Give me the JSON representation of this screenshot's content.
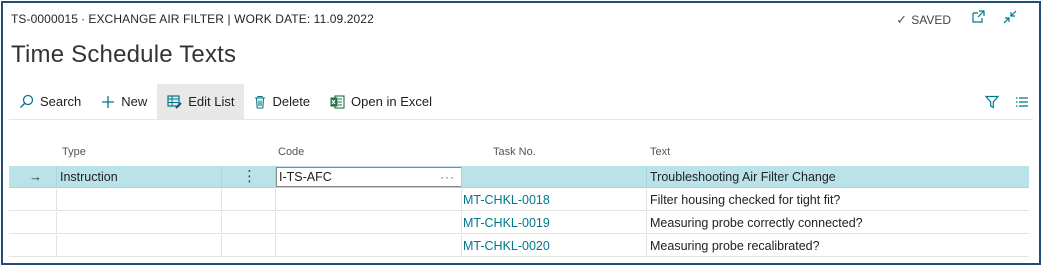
{
  "header": {
    "caption": "TS-0000015 ∙ EXCHANGE AIR FILTER | WORK DATE: 11.09.2022",
    "saved_label": "SAVED",
    "title": "Time Schedule Texts"
  },
  "actions": {
    "search": "Search",
    "new": "New",
    "edit_list": "Edit List",
    "delete": "Delete",
    "open_excel": "Open in Excel"
  },
  "columns": {
    "type": "Type",
    "code": "Code",
    "task_no": "Task No.",
    "text": "Text"
  },
  "rows": [
    {
      "type": "Instruction",
      "code": "I-TS-AFC",
      "task_no": "",
      "text": "Troubleshooting Air Filter Change"
    },
    {
      "type": "",
      "code": "",
      "task_no": "MT-CHKL-0018",
      "text": "Filter housing checked for tight fit?"
    },
    {
      "type": "",
      "code": "",
      "task_no": "MT-CHKL-0019",
      "text": "Measuring probe correctly connected?"
    },
    {
      "type": "",
      "code": "",
      "task_no": "MT-CHKL-0020",
      "text": "Measuring probe recalibrated?"
    }
  ],
  "colors": {
    "accent": "#00788a",
    "selected_row": "#b9e3e9",
    "frame": "#1f4e79"
  }
}
